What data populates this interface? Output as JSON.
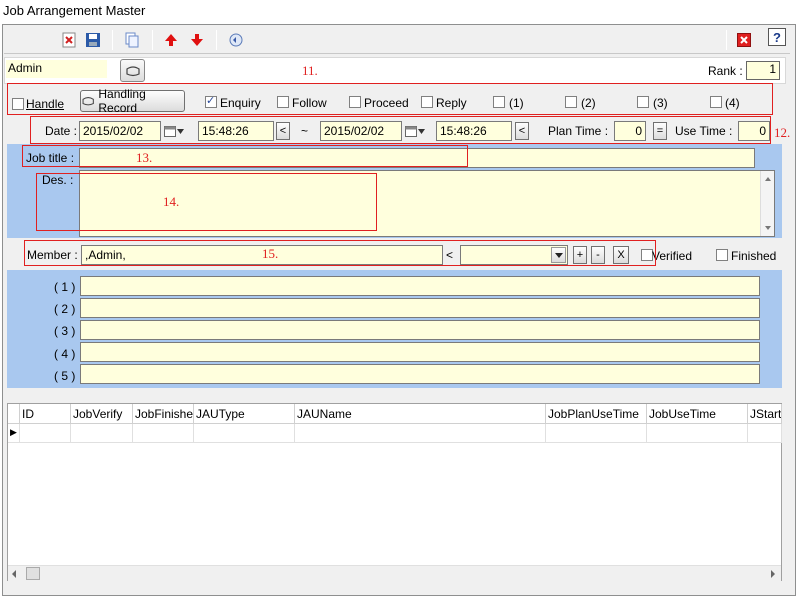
{
  "window": {
    "title": "Job Arrangement Master"
  },
  "toolbar": {
    "icons": [
      "delete-icon",
      "save-icon",
      "copy-icon",
      "arrow-up-icon",
      "arrow-down-icon",
      "refresh-icon",
      "close-icon",
      "help-icon"
    ],
    "help_label": "?"
  },
  "header": {
    "user_name": "Admin",
    "rank_label": "Rank :",
    "rank_value": "1"
  },
  "options": {
    "handle_label": "Handle",
    "handling_record_label": "Handling Record",
    "checkboxes": [
      {
        "label": "Enquiry",
        "checked": true
      },
      {
        "label": "Follow",
        "checked": false
      },
      {
        "label": "Proceed",
        "checked": false
      },
      {
        "label": "Reply",
        "checked": false
      },
      {
        "label": "(1)",
        "checked": false
      },
      {
        "label": "(2)",
        "checked": false
      },
      {
        "label": "(3)",
        "checked": false
      },
      {
        "label": "(4)",
        "checked": false
      }
    ]
  },
  "date_row": {
    "date_label": "Date :",
    "start_date": "2015/02/02",
    "start_time": "15:48:26",
    "tilde": "~",
    "end_date": "2015/02/02",
    "end_time": "15:48:26",
    "prev_label": "<",
    "plan_time_label": "Plan Time :",
    "plan_time_value": "0",
    "equals_label": "=",
    "use_time_label": "Use Time :",
    "use_time_value": "0"
  },
  "job": {
    "title_label": "Job title :",
    "title_value": "",
    "des_label": "Des. :",
    "des_value": ""
  },
  "member_row": {
    "member_label": "Member :",
    "member_value": ",Admin,",
    "lt_label": "<",
    "plus_label": "+",
    "minus_label": "-",
    "x_label": "X",
    "verified_label": "Verified",
    "finished_label": "Finished"
  },
  "numbered_fields": {
    "labels": [
      "( 1 )",
      "( 2 )",
      "( 3 )",
      "( 4 )",
      "( 5 )"
    ]
  },
  "annotations": [
    "11.",
    "12.",
    "13.",
    "14.",
    "15."
  ],
  "grid": {
    "columns": [
      "ID",
      "JobVerify",
      "JobFinished",
      "JAUType",
      "JAUName",
      "JobPlanUseTime",
      "JobUseTime",
      "JStart"
    ],
    "row_marker": "▶"
  },
  "colors": {
    "field_yellow": "#ffffdd",
    "panel_blue": "#a9c8ef",
    "annotation_red": "#e02020"
  }
}
